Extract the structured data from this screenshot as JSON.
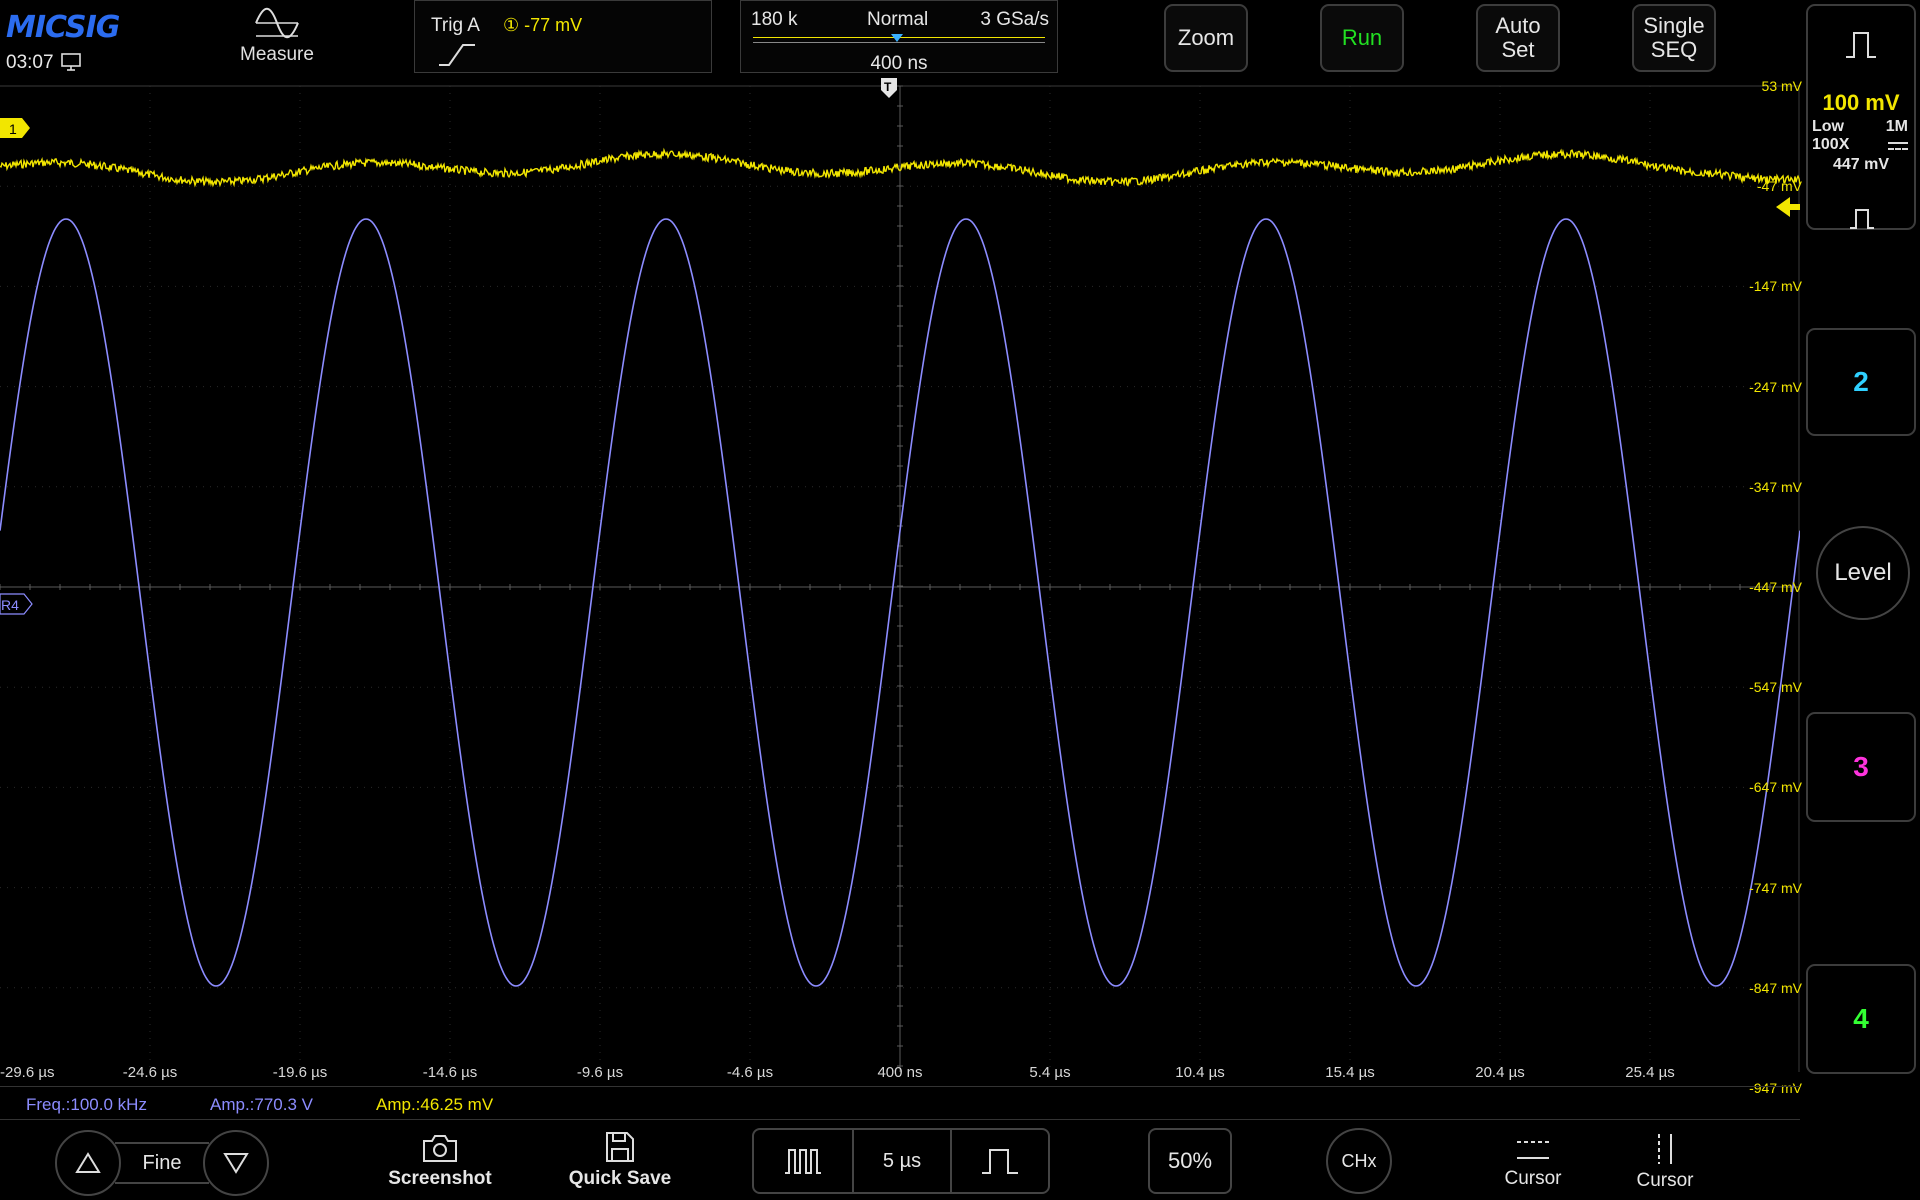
{
  "header": {
    "brand": "MICSIG",
    "time": "03:07",
    "measure_label": "Measure",
    "trig_label": "Trig  A",
    "trig_source": "① -77 mV",
    "points": "180 k",
    "acq_mode": "Normal",
    "sample_rate": "3 GSa/s",
    "time_position": "400 ns",
    "buttons": {
      "zoom": "Zoom",
      "run": "Run",
      "autoset_line1": "Auto",
      "autoset_line2": "Set",
      "single_line1": "Single",
      "single_line2": "SEQ"
    }
  },
  "channel1": {
    "marker": "1",
    "volts_per_div": "100 mV",
    "bandwidth": "Low",
    "impedance": "1M",
    "probe": "100X",
    "offset": "447 mV",
    "color": "#f2e600"
  },
  "ref4": {
    "marker": "R4",
    "color": "#8c8cff"
  },
  "right_panel": {
    "ch2": "2",
    "ch3": "3",
    "ch4": "4",
    "level": "Level",
    "ch2_color": "#2fd0ff",
    "ch3_color": "#ff33dd",
    "ch4_color": "#33ff33"
  },
  "y_axis_labels": [
    "53 mV",
    "-47 mV",
    "-147 mV",
    "-247 mV",
    "-347 mV",
    "-447 mV",
    "-547 mV",
    "-647 mV",
    "-747 mV",
    "-847 mV",
    "-947 mV"
  ],
  "x_axis_labels": [
    "-29.6 µs",
    "-24.6 µs",
    "-19.6 µs",
    "-14.6 µs",
    "-9.6 µs",
    "-4.6 µs",
    "400 ns",
    "5.4 µs",
    "10.4 µs",
    "15.4 µs",
    "20.4 µs",
    "25.4 µs"
  ],
  "trigger_marker": "T",
  "waveforms": {
    "ref4_sine": {
      "period_us": 10,
      "frequency_khz": 100.0,
      "color": "#8c8cff"
    },
    "ch1_noise": {
      "color": "#f2e600"
    }
  },
  "measurements": {
    "freq": "Freq.:100.0 kHz",
    "amp_ref": "Amp.:770.3 V",
    "amp_ch1": "Amp.:46.25 mV"
  },
  "bottom": {
    "fine": "Fine",
    "screenshot": "Screenshot",
    "quick_save": "Quick Save",
    "timebase": "5 µs",
    "trigger_level_pct": "50%",
    "chx": "CHx",
    "cursor_h": "Cursor",
    "cursor_v": "Cursor"
  }
}
